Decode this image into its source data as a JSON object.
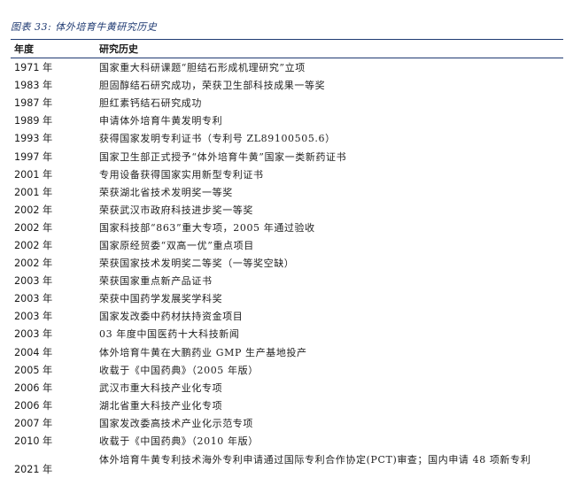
{
  "caption": "图表 33:  体外培育牛黄研究历史",
  "table": {
    "headers": {
      "year": "年度",
      "history": "研究历史"
    },
    "rows": [
      {
        "year": "1971 年",
        "text": "国家重大科研课题“胆结石形成机理研究”立项"
      },
      {
        "year": "1983 年",
        "text": "胆固醇结石研究成功，荣获卫生部科技成果一等奖"
      },
      {
        "year": "1987 年",
        "text": "胆红素钙结石研究成功"
      },
      {
        "year": "1989 年",
        "text": "申请体外培育牛黄发明专利"
      },
      {
        "year": "1993 年",
        "text": "获得国家发明专利证书（专利号 ZL89100505.6）"
      },
      {
        "year": "1997 年",
        "text": "国家卫生部正式授予“体外培育牛黄”国家一类新药证书"
      },
      {
        "year": "2001 年",
        "text": "专用设备获得国家实用新型专利证书"
      },
      {
        "year": "2001 年",
        "text": "荣获湖北省技术发明奖一等奖"
      },
      {
        "year": "2002 年",
        "text": "荣获武汉市政府科技进步奖一等奖"
      },
      {
        "year": "2002 年",
        "text": "国家科技部“863”重大专项，2005 年通过验收"
      },
      {
        "year": "2002 年",
        "text": "国家原经贸委“双高一优”重点项目"
      },
      {
        "year": "2002 年",
        "text": "荣获国家技术发明奖二等奖（一等奖空缺）"
      },
      {
        "year": "2003 年",
        "text": "荣获国家重点新产品证书"
      },
      {
        "year": "2003 年",
        "text": "荣获中国药学发展奖学科奖"
      },
      {
        "year": "2003 年",
        "text": "国家发改委中药材扶持资金项目"
      },
      {
        "year": "2003 年",
        "text": "03 年度中国医药十大科技新闻"
      },
      {
        "year": "2004 年",
        "text": "体外培育牛黄在大鹏药业 GMP 生产基地投产"
      },
      {
        "year": "2005 年",
        "text": "收载于《中国药典》（2005 年版）"
      },
      {
        "year": "2006 年",
        "text": "武汉市重大科技产业化专项"
      },
      {
        "year": "2006 年",
        "text": "湖北省重大科技产业化专项"
      },
      {
        "year": "2007 年",
        "text": "国家发改委高技术产业化示范专项"
      },
      {
        "year": "2010 年",
        "text": "收载于《中国药典》（2010 年版）"
      },
      {
        "year": "2021 年",
        "text": "体外培育牛黄专利技术海外专利申请通过国际专利合作协定(PCT)审查；国内申请 48 项新专利"
      }
    ]
  },
  "colors": {
    "accent": "#1f3a72"
  }
}
